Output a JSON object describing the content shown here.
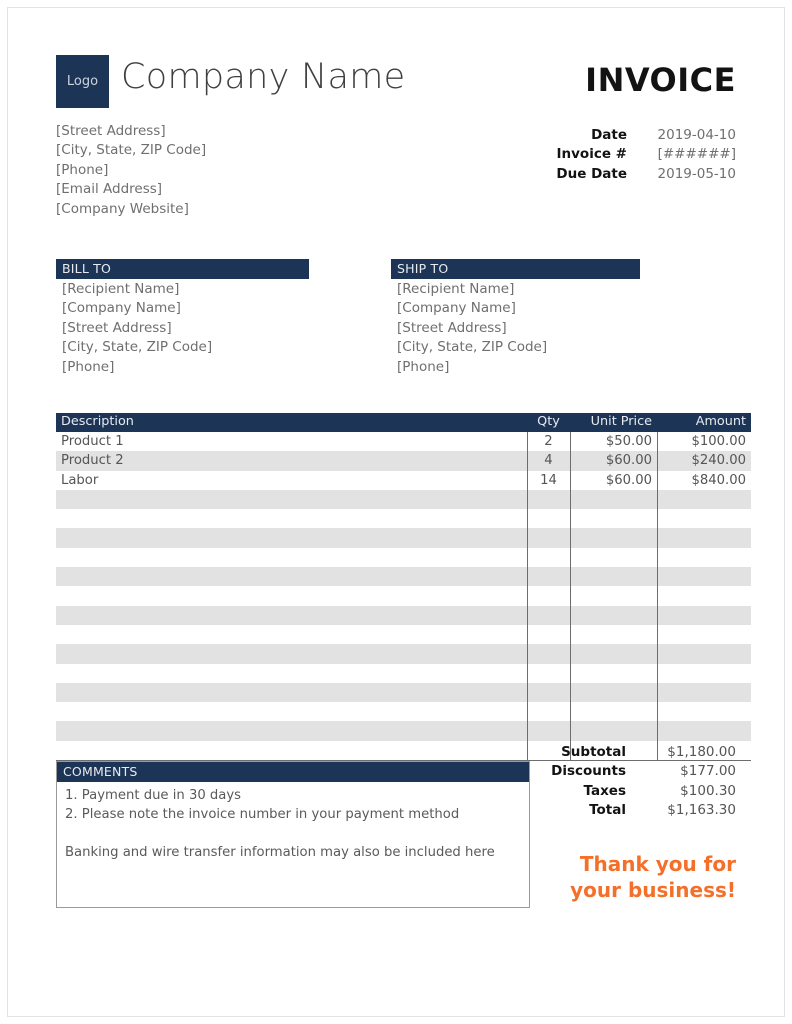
{
  "colors": {
    "navy": "#1c3557",
    "orange": "#f4702a",
    "row_alt": "#e2e2e2",
    "rule": "#6d6d6d"
  },
  "header": {
    "logo_label": "Logo",
    "company_name": "Company Name",
    "company_address": [
      "[Street Address]",
      "[City, State, ZIP Code]",
      "[Phone]",
      "[Email Address]",
      "[Company Website]"
    ],
    "invoice_word": "INVOICE",
    "meta": [
      {
        "label": "Date",
        "value": "2019-04-10"
      },
      {
        "label": "Invoice #",
        "value": "[######]"
      },
      {
        "label": "Due Date",
        "value": "2019-05-10"
      }
    ]
  },
  "bill_to": {
    "title": "BILL TO",
    "lines": [
      "[Recipient Name]",
      "[Company Name]",
      "[Street Address]",
      "[City, State, ZIP Code]",
      "[Phone]"
    ]
  },
  "ship_to": {
    "title": "SHIP TO",
    "lines": [
      "[Recipient Name]",
      "[Company Name]",
      "[Street Address]",
      "[City, State, ZIP Code]",
      "[Phone]"
    ]
  },
  "items_table": {
    "columns": [
      "Description",
      "Qty",
      "Unit Price",
      "Amount"
    ],
    "rows": [
      {
        "description": "Product 1",
        "qty": "2",
        "unit_price": "$50.00",
        "amount": "$100.00"
      },
      {
        "description": "Product 2",
        "qty": "4",
        "unit_price": "$60.00",
        "amount": "$240.00"
      },
      {
        "description": "Labor",
        "qty": "14",
        "unit_price": "$60.00",
        "amount": "$840.00"
      }
    ],
    "empty_row_count": 14
  },
  "totals": [
    {
      "label": "Subtotal",
      "value": "$1,180.00"
    },
    {
      "label": "Discounts",
      "value": "$177.00"
    },
    {
      "label": "Taxes",
      "value": "$100.30"
    },
    {
      "label": "Total",
      "value": "$1,163.30"
    }
  ],
  "comments": {
    "title": "COMMENTS",
    "lines": [
      "1. Payment due in 30 days",
      "2. Please note the invoice number in your payment method"
    ],
    "note": "Banking and wire transfer information may also be included here"
  },
  "thanks": {
    "line1": "Thank you for",
    "line2": "your business!"
  }
}
